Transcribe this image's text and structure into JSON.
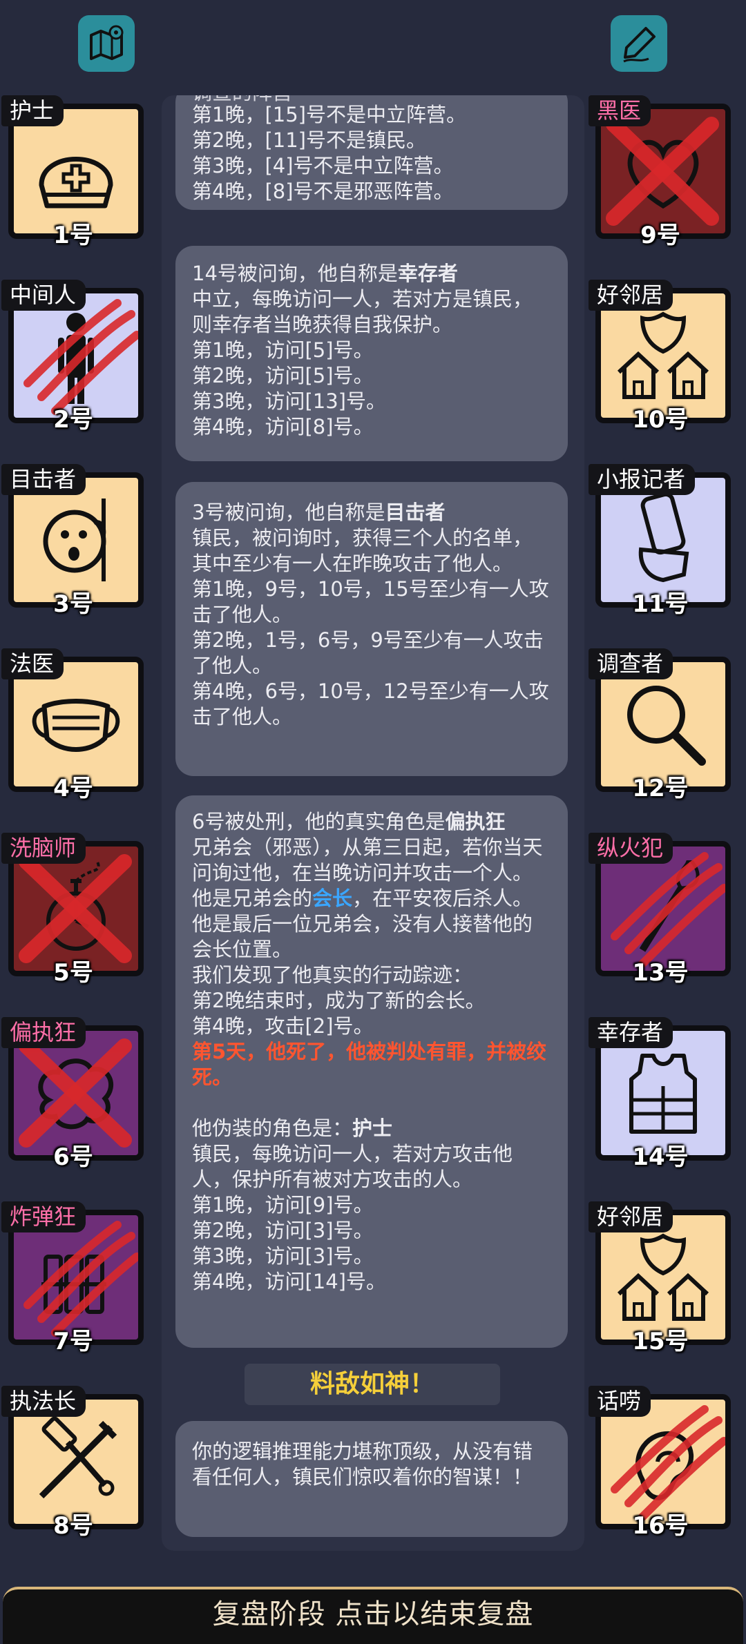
{
  "top": {
    "map_icon": "map-pin-icon",
    "notes_icon": "pen-icon"
  },
  "left_cards": [
    {
      "role": "护士",
      "number": "1号",
      "icon": "nurse-cap-icon",
      "theme": "peach",
      "role_color": "white",
      "marked": "none"
    },
    {
      "role": "中间人",
      "number": "2号",
      "icon": "person-icon",
      "theme": "lavender",
      "role_color": "white",
      "marked": "claw"
    },
    {
      "role": "目击者",
      "number": "3号",
      "icon": "peeking-face-icon",
      "theme": "peach",
      "role_color": "white",
      "marked": "none"
    },
    {
      "role": "法医",
      "number": "4号",
      "icon": "mask-icon",
      "theme": "peach",
      "role_color": "white",
      "marked": "none"
    },
    {
      "role": "洗脑师",
      "number": "5号",
      "icon": "pocket-watch-icon",
      "theme": "red",
      "role_color": "pink",
      "marked": "cross"
    },
    {
      "role": "偏执狂",
      "number": "6号",
      "icon": "brain-icon",
      "theme": "purple",
      "role_color": "pink",
      "marked": "cross"
    },
    {
      "role": "炸弹狂",
      "number": "7号",
      "icon": "dynamite-icon",
      "theme": "purple",
      "role_color": "pink",
      "marked": "claw"
    },
    {
      "role": "执法长",
      "number": "8号",
      "icon": "gavel-sword-icon",
      "theme": "peach",
      "role_color": "white",
      "marked": "none"
    }
  ],
  "right_cards": [
    {
      "role": "黑医",
      "number": "9号",
      "icon": "heart-icon",
      "theme": "red",
      "role_color": "pink",
      "marked": "cross"
    },
    {
      "role": "好邻居",
      "number": "10号",
      "icon": "houses-shield-icon",
      "theme": "peach",
      "role_color": "white",
      "marked": "none"
    },
    {
      "role": "小报记者",
      "number": "11号",
      "icon": "newspaper-hand-icon",
      "theme": "lavender",
      "role_color": "white",
      "marked": "none"
    },
    {
      "role": "调查者",
      "number": "12号",
      "icon": "magnifier-icon",
      "theme": "peach",
      "role_color": "white",
      "marked": "none"
    },
    {
      "role": "纵火犯",
      "number": "13号",
      "icon": "torch-icon",
      "theme": "purple",
      "role_color": "pink",
      "marked": "claw"
    },
    {
      "role": "幸存者",
      "number": "14号",
      "icon": "vest-icon",
      "theme": "lavender",
      "role_color": "white",
      "marked": "none"
    },
    {
      "role": "好邻居",
      "number": "15号",
      "icon": "houses-shield-icon",
      "theme": "peach",
      "role_color": "white",
      "marked": "none"
    },
    {
      "role": "话唠",
      "number": "16号",
      "icon": "ear-icon",
      "theme": "peach",
      "role_color": "white",
      "marked": "claw"
    }
  ],
  "messages": {
    "m1": {
      "line0": "调查的阵营",
      "line1": "第1晚，[15]号不是中立阵营。",
      "line2": "第2晚，[11]号不是镇民。",
      "line3": "第3晚，[4]号不是中立阵营。",
      "line4": "第4晚，[8]号不是邪恶阵营。"
    },
    "m2": {
      "intro": "14号被问询，他自称是",
      "role": "幸存者",
      "desc": "中立，每晚访问一人，若对方是镇民，则幸存者当晚获得自我保护。",
      "l1": "第1晚，访问[5]号。",
      "l2": "第2晚，访问[5]号。",
      "l3": "第3晚，访问[13]号。",
      "l4": "第4晚，访问[8]号。"
    },
    "m3": {
      "intro": "3号被问询，他自称是",
      "role": "目击者",
      "desc": "镇民，被问询时，获得三个人的名单，其中至少有一人在昨晚攻击了他人。",
      "l1": "第1晚，9号，10号，15号至少有一人攻击了他人。",
      "l2": "第2晚，1号，6号，9号至少有一人攻击了他人。",
      "l3": "第4晚，6号，10号，12号至少有一人攻击了他人。"
    },
    "m4": {
      "intro": "6号被处刑，他的真实角色是",
      "role": "偏执狂",
      "desc": "兄弟会（邪恶），从第三日起，若你当天问询过他，在当晚访问并攻击一个人。",
      "leader_pre": "他是兄弟会的",
      "leader": "会长",
      "leader_post": "，在平安夜后杀人。他是最后一位兄弟会，没有人接替他的会长位置。",
      "trail": "我们发现了他真实的行动踪迹：",
      "t1": "第2晚结束时，成为了新的会长。",
      "t2": "第4晚，攻击[2]号。",
      "verdict": "第5天，他死了，他被判处有罪，并被绞死。",
      "fake_pre": "他伪装的角色是：",
      "fake_role": "护士",
      "fake_desc": "镇民，每晚访问一人，若对方攻击他人，保护所有被对方攻击的人。",
      "f1": "第1晚，访问[9]号。",
      "f2": "第2晚，访问[3]号。",
      "f3": "第3晚，访问[3]号。",
      "f4": "第4晚，访问[14]号。"
    },
    "m5": {
      "text": "你的逻辑推理能力堪称顶级，从没有错看任何人，镇民们惊叹着你的智谋！！"
    }
  },
  "banner": "料敌如神！",
  "bottom_bar": "复盘阶段 点击以结束复盘",
  "colors": {
    "background": "#262a3d",
    "teal_button": "#2b8e9b",
    "peach": "#fad9a1",
    "lavender": "#cfd0f5",
    "dead_red": "#7a2224",
    "evil_purple": "#6e2e78",
    "highlight_red": "#ff5530",
    "highlight_blue": "#3aa6ff",
    "banner_gold": "#f5cf3a"
  }
}
